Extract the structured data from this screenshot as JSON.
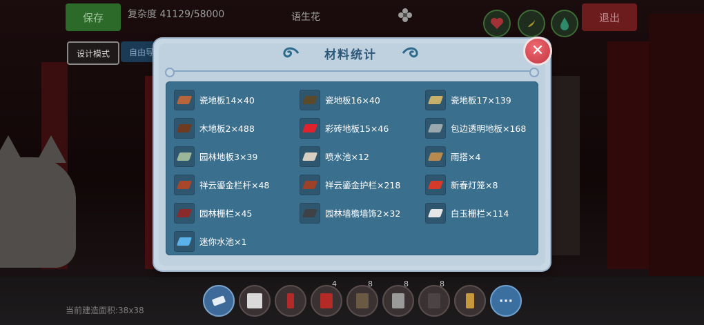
{
  "hud": {
    "save_label": "保存",
    "complexity_text": "复杂度 41129/58000",
    "build_name": "语生花",
    "design_mode_label": "设计模式",
    "export_label": "自由导",
    "exit_label": "退出",
    "area_text": "当前建造面积:38x38"
  },
  "modal": {
    "title": "材料统计",
    "close_label": "✕",
    "materials": [
      {
        "label": "瓷地板14×40",
        "icon": "tile-floor-icon",
        "color": "#b8643c"
      },
      {
        "label": "瓷地板16×40",
        "icon": "tile-floor-icon",
        "color": "#5a4a2a"
      },
      {
        "label": "瓷地板17×139",
        "icon": "tile-floor-icon",
        "color": "#c9b06a"
      },
      {
        "label": "木地板2×488",
        "icon": "wood-floor-icon",
        "color": "#6e3a22"
      },
      {
        "label": "彩砖地板15×46",
        "icon": "color-brick-floor-icon",
        "color": "#e0222d"
      },
      {
        "label": "包边透明地板×168",
        "icon": "transparent-floor-icon",
        "color": "#9aa8ad"
      },
      {
        "label": "园林地板3×39",
        "icon": "garden-floor-icon",
        "color": "#9bb79a"
      },
      {
        "label": "喷水池×12",
        "icon": "fountain-icon",
        "color": "#d7d0c2"
      },
      {
        "label": "雨搭×4",
        "icon": "canopy-icon",
        "color": "#b88a4e"
      },
      {
        "label": "祥云鎏金栏杆×48",
        "icon": "railing-icon",
        "color": "#a8472a"
      },
      {
        "label": "祥云鎏金护栏×218",
        "icon": "guardrail-icon",
        "color": "#9d4228"
      },
      {
        "label": "新春灯笼×8",
        "icon": "lantern-icon",
        "color": "#d63a2a"
      },
      {
        "label": "园林栅栏×45",
        "icon": "fence-icon",
        "color": "#8a2a2a"
      },
      {
        "label": "园林墙檐墙饰2×32",
        "icon": "wall-eave-icon",
        "color": "#3e4246"
      },
      {
        "label": "白玉栅栏×114",
        "icon": "jade-fence-icon",
        "color": "#e6e6e6"
      },
      {
        "label": "迷你水池×1",
        "icon": "mini-pool-icon",
        "color": "#5bb2ea"
      }
    ]
  },
  "hotbar": [
    {
      "icon": "eraser-icon",
      "count": ""
    },
    {
      "icon": "jade-fence-icon",
      "count": ""
    },
    {
      "icon": "red-pillar-icon",
      "count": ""
    },
    {
      "icon": "red-panel-icon",
      "count": "4"
    },
    {
      "icon": "wood-door-icon",
      "count": "8"
    },
    {
      "icon": "grey-panel-icon",
      "count": "8"
    },
    {
      "icon": "dark-screen-icon",
      "count": "8"
    },
    {
      "icon": "gold-pillar-icon",
      "count": ""
    },
    {
      "icon": "more-icon",
      "count": "",
      "label": "···"
    }
  ]
}
